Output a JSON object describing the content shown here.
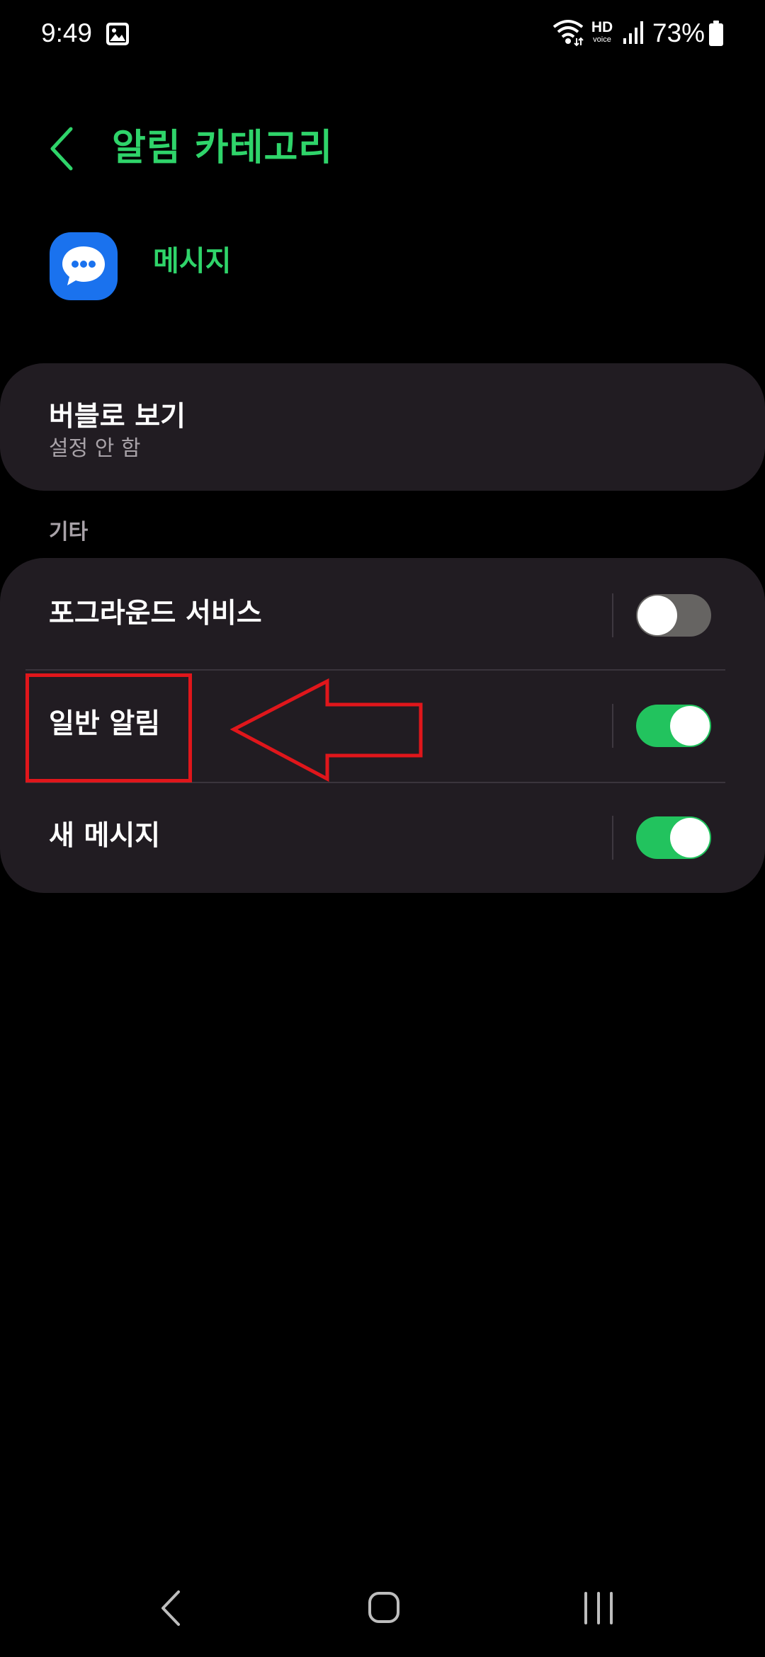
{
  "status_bar": {
    "time": "9:49",
    "hd_label": "HD",
    "voice_label": "voice",
    "battery": "73%"
  },
  "header": {
    "title": "알림 카테고리"
  },
  "app": {
    "name": "메시지",
    "icon": "chat-bubble-icon",
    "icon_color": "#1a72ee"
  },
  "bubble_setting": {
    "title": "버블로 보기",
    "subtitle": "설정 안 함"
  },
  "section": {
    "label": "기타"
  },
  "rows": [
    {
      "label": "포그라운드 서비스",
      "enabled": false
    },
    {
      "label": "일반 알림",
      "enabled": true
    },
    {
      "label": "새 메시지",
      "enabled": true
    }
  ],
  "colors": {
    "accent": "#2fd46a",
    "toggle_on": "#22c35e",
    "toggle_off": "#666462",
    "card_background": "#211c22",
    "annotation": "#e0161b"
  },
  "navigation": [
    "back-icon",
    "home-icon",
    "recent-apps-icon"
  ]
}
